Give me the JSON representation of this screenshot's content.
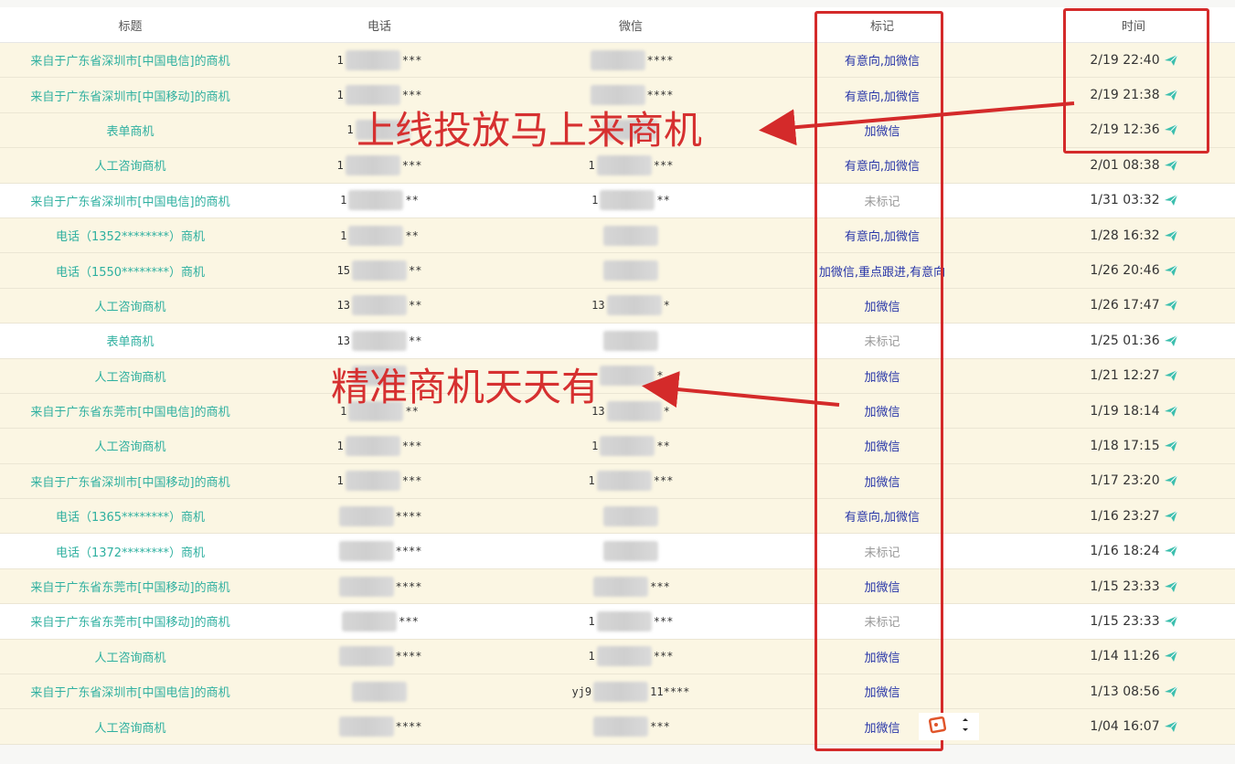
{
  "header": {
    "title": "标题",
    "phone": "电话",
    "wechat": "微信",
    "mark": "标记",
    "time": "时间"
  },
  "rows": [
    {
      "title": "来自于广东省深圳市[中国电信]的商机",
      "phone_pre": "1",
      "phone_suf": "***",
      "wx_pre": "",
      "wx_suf": "****",
      "mark": "有意向,加微信",
      "time": "2/19 22:40"
    },
    {
      "title": "来自于广东省深圳市[中国移动]的商机",
      "phone_pre": "1",
      "phone_suf": "***",
      "wx_pre": "",
      "wx_suf": "****",
      "mark": "有意向,加微信",
      "time": "2/19 21:38"
    },
    {
      "title": "表单商机",
      "phone_pre": "1",
      "phone_suf": "",
      "wx_pre": "",
      "wx_suf": "",
      "mark": "加微信",
      "time": "2/19 12:36"
    },
    {
      "title": "人工咨询商机",
      "phone_pre": "1",
      "phone_suf": "***",
      "wx_pre": "1",
      "wx_suf": "***",
      "mark": "有意向,加微信",
      "time": "2/01 08:38"
    },
    {
      "title": "来自于广东省深圳市[中国电信]的商机",
      "phone_pre": "1",
      "phone_suf": "**",
      "wx_pre": "1",
      "wx_suf": "**",
      "mark": "未标记",
      "time": "1/31 03:32"
    },
    {
      "title": "电话（1352********）商机",
      "phone_pre": "1",
      "phone_suf": "**",
      "wx_pre": "",
      "wx_suf": "",
      "mark": "有意向,加微信",
      "time": "1/28 16:32"
    },
    {
      "title": "电话（1550********）商机",
      "phone_pre": "15",
      "phone_suf": "**",
      "wx_pre": "",
      "wx_suf": "",
      "mark": "加微信,重点跟进,有意向",
      "time": "1/26 20:46"
    },
    {
      "title": "人工咨询商机",
      "phone_pre": "13",
      "phone_suf": "**",
      "wx_pre": "13",
      "wx_suf": "*",
      "mark": "加微信",
      "time": "1/26 17:47"
    },
    {
      "title": "表单商机",
      "phone_pre": "13",
      "phone_suf": "**",
      "wx_pre": "",
      "wx_suf": "",
      "mark": "未标记",
      "time": "1/25 01:36"
    },
    {
      "title": "人工咨询商机",
      "phone_pre": "",
      "phone_suf": "",
      "wx_pre": "",
      "wx_suf": "*",
      "mark": "加微信",
      "time": "1/21 12:27"
    },
    {
      "title": "来自于广东省东莞市[中国电信]的商机",
      "phone_pre": "1",
      "phone_suf": "**",
      "wx_pre": "13",
      "wx_suf": "*",
      "mark": "加微信",
      "time": "1/19 18:14"
    },
    {
      "title": "人工咨询商机",
      "phone_pre": "1",
      "phone_suf": "***",
      "wx_pre": "1",
      "wx_suf": "**",
      "mark": "加微信",
      "time": "1/18 17:15"
    },
    {
      "title": "来自于广东省深圳市[中国移动]的商机",
      "phone_pre": "1",
      "phone_suf": "***",
      "wx_pre": "1",
      "wx_suf": "***",
      "mark": "加微信",
      "time": "1/17 23:20"
    },
    {
      "title": "电话（1365********）商机",
      "phone_pre": "",
      "phone_suf": "****",
      "wx_pre": "",
      "wx_suf": "",
      "mark": "有意向,加微信",
      "time": "1/16 23:27"
    },
    {
      "title": "电话（1372********）商机",
      "phone_pre": "",
      "phone_suf": "****",
      "wx_pre": "",
      "wx_suf": "",
      "mark": "未标记",
      "time": "1/16 18:24"
    },
    {
      "title": "来自于广东省东莞市[中国移动]的商机",
      "phone_pre": "",
      "phone_suf": "****",
      "wx_pre": "",
      "wx_suf": "***",
      "mark": "加微信",
      "time": "1/15 23:33"
    },
    {
      "title": "来自于广东省东莞市[中国移动]的商机",
      "phone_pre": "",
      "phone_suf": "***",
      "wx_pre": "1",
      "wx_suf": "***",
      "mark": "未标记",
      "time": "1/15 23:33"
    },
    {
      "title": "人工咨询商机",
      "phone_pre": "",
      "phone_suf": "****",
      "wx_pre": "1",
      "wx_suf": "***",
      "mark": "加微信",
      "time": "1/14 11:26"
    },
    {
      "title": "来自于广东省深圳市[中国电信]的商机",
      "phone_pre": "",
      "phone_suf": "",
      "wx_pre": "yj9",
      "wx_suf": "11****",
      "mark": "加微信",
      "time": "1/13 08:56"
    },
    {
      "title": "人工咨询商机",
      "phone_pre": "",
      "phone_suf": "****",
      "wx_pre": "",
      "wx_suf": "***",
      "mark": "加微信",
      "time": "1/04 16:07"
    }
  ],
  "annotations": {
    "top": "上线投放马上来商机",
    "middle": "精准商机天天有"
  },
  "colors": {
    "title_link": "#2fb0a0",
    "mark_text": "#2836a8",
    "unmarked_text": "#999999",
    "highlight_red": "#d42a2a",
    "row_yellow": "#fbf6e3"
  },
  "icons": {
    "send": "paper-plane-icon",
    "tool1": "edit-note-icon",
    "tool2": "more-vertical-icon"
  }
}
